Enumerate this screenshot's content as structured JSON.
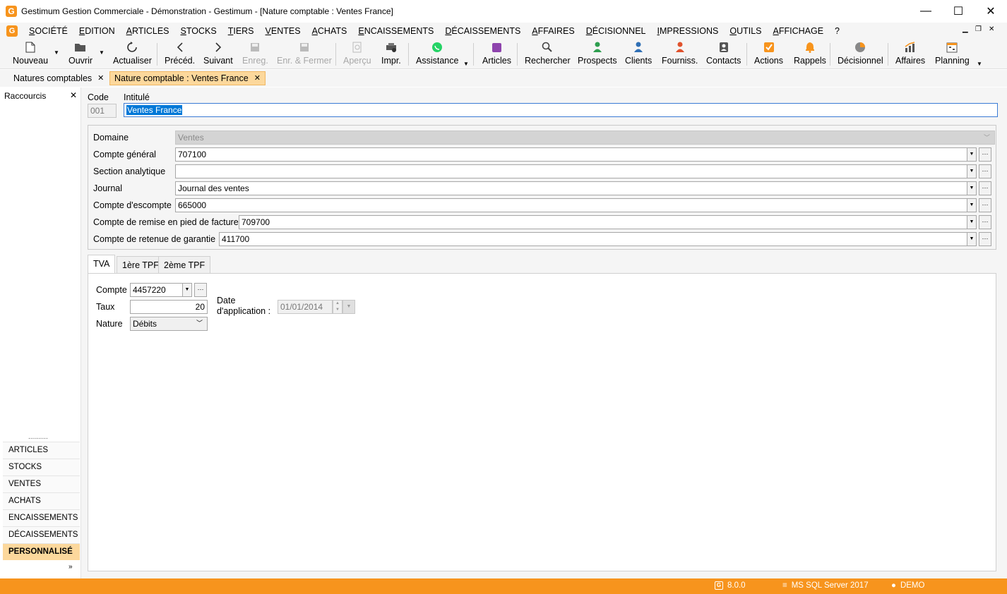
{
  "window": {
    "title": "Gestimum Gestion Commerciale - Démonstration - Gestimum - [Nature comptable : Ventes France]",
    "logo": "G",
    "minimize": "—",
    "maximize": "☐",
    "close": "✕"
  },
  "menu": [
    "SOCIÉTÉ",
    "EDITION",
    "ARTICLES",
    "STOCKS",
    "TIERS",
    "VENTES",
    "ACHATS",
    "ENCAISSEMENTS",
    "DÉCAISSEMENTS",
    "AFFAIRES",
    "DÉCISIONNEL",
    "IMPRESSIONS",
    "OUTILS",
    "AFFICHAGE",
    "?"
  ],
  "toolbar": {
    "nouveau": "Nouveau",
    "ouvrir": "Ouvrir",
    "actualiser": "Actualiser",
    "preced": "Précéd.",
    "suivant": "Suivant",
    "enreg": "Enreg.",
    "enr_fermer": "Enr. & Fermer",
    "apercu": "Aperçu",
    "impr": "Impr.",
    "assistance": "Assistance",
    "articles": "Articles",
    "rechercher": "Rechercher",
    "prospects": "Prospects",
    "clients": "Clients",
    "fourniss": "Fourniss.",
    "contacts": "Contacts",
    "actions": "Actions",
    "rappels": "Rappels",
    "decisionnel": "Décisionnel",
    "affaires": "Affaires",
    "planning": "Planning"
  },
  "doc_tabs": {
    "tab1": "Natures comptables",
    "tab2": "Nature comptable : Ventes France",
    "close": "✕"
  },
  "left_panel": {
    "title": "Raccourcis",
    "close": "✕",
    "grip": "..........",
    "more": "»",
    "sections": [
      "ARTICLES",
      "STOCKS",
      "VENTES",
      "ACHATS",
      "ENCAISSEMENTS",
      "DÉCAISSEMENTS",
      "PERSONNALISÉ"
    ]
  },
  "form": {
    "code_label": "Code",
    "code_value": "001",
    "intitule_label": "Intitulé",
    "intitule_value": "Ventes France",
    "domaine_label": "Domaine",
    "domaine_value": "Ventes",
    "compte_general_label": "Compte général",
    "compte_general_value": "707100",
    "section_analytique_label": "Section analytique",
    "section_analytique_value": "",
    "journal_label": "Journal",
    "journal_value": "Journal des ventes",
    "compte_escompte_label": "Compte d'escompte",
    "compte_escompte_value": "665000",
    "compte_remise_label": "Compte de remise en pied de facture",
    "compte_remise_value": "709700",
    "compte_retenue_label": "Compte de retenue de garantie",
    "compte_retenue_value": "411700"
  },
  "tabs": {
    "tva": "TVA",
    "tpf1": "1ère TPF",
    "tpf2": "2ème TPF"
  },
  "tva": {
    "compte_label": "Compte",
    "compte_value": "4457220",
    "taux_label": "Taux",
    "taux_value": "20",
    "nature_label": "Nature",
    "nature_value": "Débits",
    "date_label_1": "Date",
    "date_label_2": "d'application :",
    "date_value": "01/01/2014"
  },
  "status": {
    "version": "8.0.0",
    "server": "MS SQL Server 2017",
    "user": "DEMO"
  },
  "colors": {
    "accent": "#f7941d",
    "active_tab": "#fcd89c",
    "selection": "#0078d7"
  }
}
